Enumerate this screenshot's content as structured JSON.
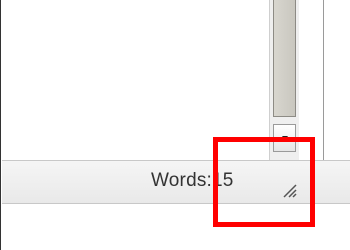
{
  "status_bar": {
    "word_count_label": "Words:",
    "word_count_value": "15"
  },
  "annotation": {
    "highlight_color": "#ff0000"
  },
  "icons": {
    "scroll_down": "chevron-down-icon",
    "resize": "resize-grip-icon"
  }
}
